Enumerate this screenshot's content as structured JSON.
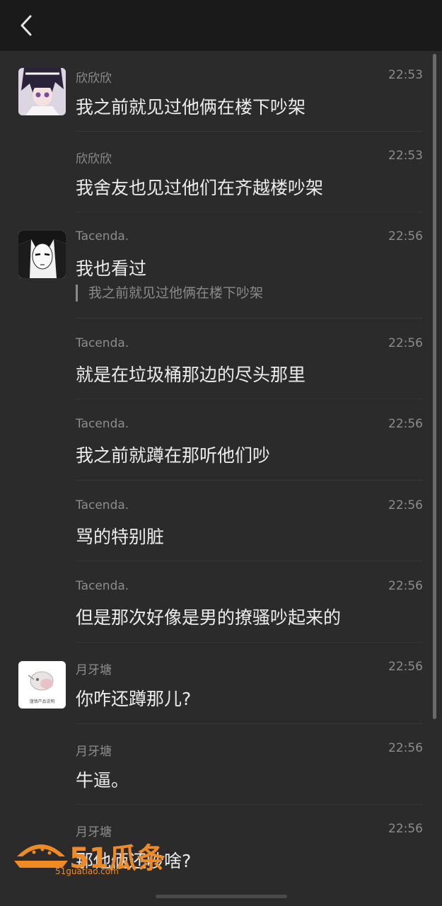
{
  "messages": [
    {
      "sender": "欣欣欣",
      "time": "22:53",
      "text": "我之前就见过他俩在楼下吵架"
    },
    {
      "sender": "欣欣欣",
      "time": "22:53",
      "text": "我舍友也见过他们在齐越楼吵架"
    },
    {
      "sender": "Tacenda.",
      "time": "22:56",
      "text": "我也看过",
      "quote": "我之前就见过他俩在楼下吵架"
    },
    {
      "sender": "Tacenda.",
      "time": "22:56",
      "text": "就是在垃圾桶那边的尽头那里"
    },
    {
      "sender": "Tacenda.",
      "time": "22:56",
      "text": "我之前就蹲在那听他们吵"
    },
    {
      "sender": "Tacenda.",
      "time": "22:56",
      "text": "骂的特别脏"
    },
    {
      "sender": "Tacenda.",
      "time": "22:56",
      "text": "但是那次好像是男的撩骚吵起来的"
    },
    {
      "sender": "月牙塘",
      "time": "22:56",
      "text": "你咋还蹲那儿?",
      "avatar_caption": "谨慎产品说明"
    },
    {
      "sender": "月牙塘",
      "time": "22:56",
      "text": "牛逼。"
    },
    {
      "sender": "月牙塘",
      "time": "22:56",
      "text": "那他俩还吵啥?"
    }
  ],
  "watermark": {
    "brand": "51瓜条",
    "url": "51guatiao.com"
  },
  "colors": {
    "topbar": "#1a1a1a",
    "background": "#2b2b2b",
    "accent": "#f08a24"
  },
  "icons": {
    "back": "chevron-left-icon"
  }
}
